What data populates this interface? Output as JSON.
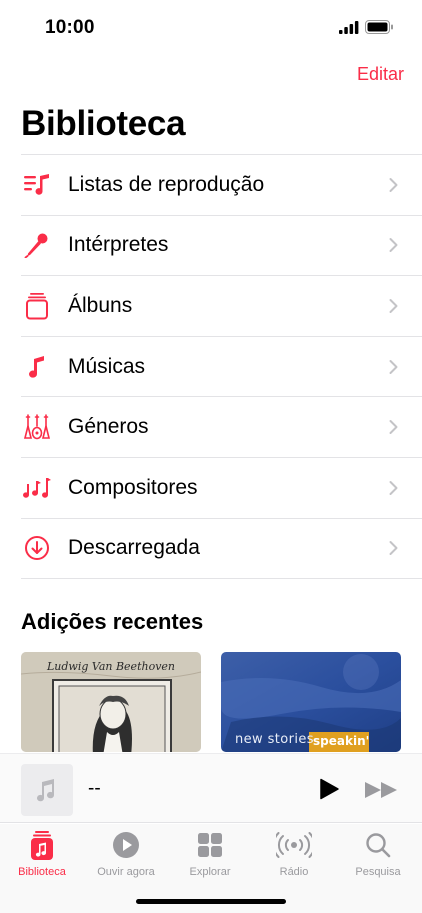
{
  "status": {
    "time": "10:00"
  },
  "header": {
    "edit_label": "Editar",
    "title": "Biblioteca"
  },
  "accent_color": "#fa2d48",
  "menu": [
    {
      "label": "Listas de reprodução",
      "icon": "playlist-icon"
    },
    {
      "label": "Intérpretes",
      "icon": "microphone-icon"
    },
    {
      "label": "Álbuns",
      "icon": "album-stack-icon"
    },
    {
      "label": "Músicas",
      "icon": "music-note-icon"
    },
    {
      "label": "Géneros",
      "icon": "guitars-icon"
    },
    {
      "label": "Compositores",
      "icon": "notes-icon"
    },
    {
      "label": "Descarregada",
      "icon": "download-circle-icon"
    }
  ],
  "recent": {
    "title": "Adições recentes",
    "albums": [
      {
        "art_text": "Ludwig Van Beethoven"
      },
      {
        "art_text_1": "new stories",
        "art_text_2": "speakin'"
      }
    ]
  },
  "mini_player": {
    "title": "--"
  },
  "tabs": [
    {
      "label": "Biblioteca",
      "icon": "library-icon",
      "active": true
    },
    {
      "label": "Ouvir agora",
      "icon": "play-circle-icon",
      "active": false
    },
    {
      "label": "Explorar",
      "icon": "grid-icon",
      "active": false
    },
    {
      "label": "Rádio",
      "icon": "radio-waves-icon",
      "active": false
    },
    {
      "label": "Pesquisa",
      "icon": "search-icon",
      "active": false
    }
  ]
}
